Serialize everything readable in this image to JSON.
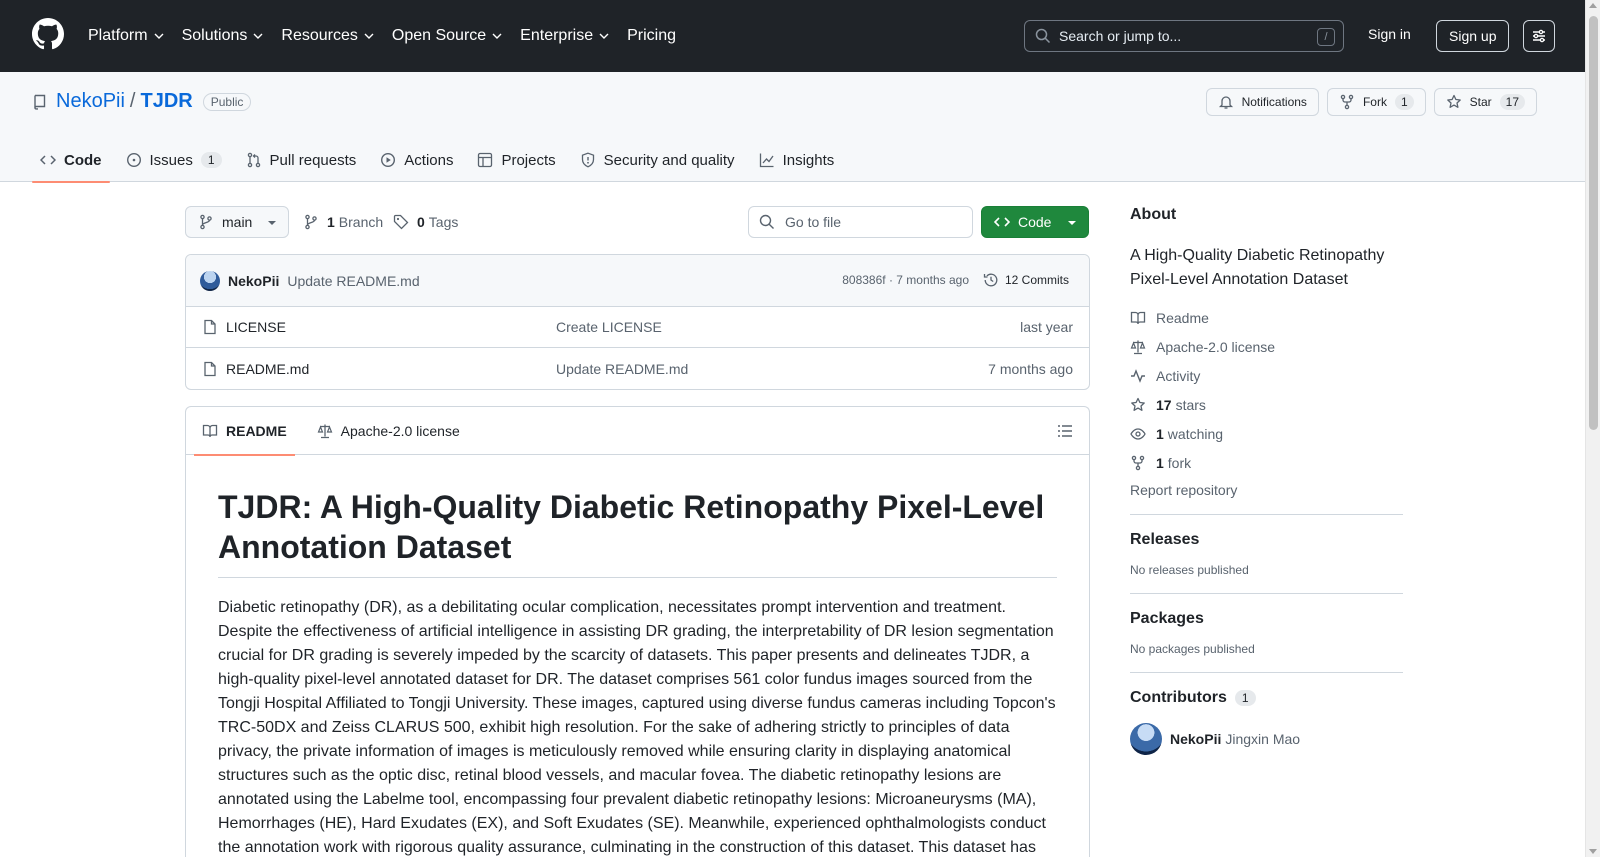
{
  "header": {
    "nav": [
      "Platform",
      "Solutions",
      "Resources",
      "Open Source",
      "Enterprise",
      "Pricing"
    ],
    "search_placeholder": "Search or jump to...",
    "search_shortcut": "/",
    "sign_in": "Sign in",
    "sign_up": "Sign up"
  },
  "repo": {
    "owner": "NekoPii",
    "separator": "/",
    "name": "TJDR",
    "visibility": "Public",
    "actions": {
      "notifications": "Notifications",
      "fork": "Fork",
      "fork_count": "1",
      "star": "Star",
      "star_count": "17"
    },
    "tabs": [
      {
        "label": "Code",
        "icon": "code-icon"
      },
      {
        "label": "Issues",
        "icon": "issue-icon",
        "count": "1"
      },
      {
        "label": "Pull requests",
        "icon": "pull-request-icon"
      },
      {
        "label": "Actions",
        "icon": "play-icon"
      },
      {
        "label": "Projects",
        "icon": "table-icon"
      },
      {
        "label": "Security and quality",
        "icon": "shield-icon"
      },
      {
        "label": "Insights",
        "icon": "graph-icon"
      }
    ]
  },
  "toolbar": {
    "branch": "main",
    "branch_count": "1",
    "branch_label": "Branch",
    "tag_count": "0",
    "tag_label": "Tags",
    "go_to_file": "Go to file",
    "code_button": "Code"
  },
  "latest_commit": {
    "author": "NekoPii",
    "message": "Update README.md",
    "meta": "808386f · 7 months ago",
    "commits": "12 Commits"
  },
  "files": [
    {
      "name": "LICENSE",
      "message": "Create LICENSE",
      "time": "last year"
    },
    {
      "name": "README.md",
      "message": "Update README.md",
      "time": "7 months ago"
    }
  ],
  "readme": {
    "tab_readme": "README",
    "tab_license": "Apache-2.0 license",
    "title": "TJDR: A High-Quality Diabetic Retinopathy Pixel-Level Annotation Dataset",
    "body": "Diabetic retinopathy (DR), as a debilitating ocular complication, necessitates prompt intervention and treatment. Despite the effectiveness of artificial intelligence in assisting DR grading, the interpretability of DR lesion segmentation crucial for DR grading is severely impeded by the scarcity of datasets. This paper presents and delineates TJDR, a high-quality pixel-level annotated dataset for DR. The dataset comprises 561 color fundus images sourced from the Tongji Hospital Affiliated to Tongji University. These images, captured using diverse fundus cameras including Topcon's TRC-50DX and Zeiss CLARUS 500, exhibit high resolution. For the sake of adhering strictly to principles of data privacy, the private information of images is meticulously removed while ensuring clarity in displaying anatomical structures such as the optic disc, retinal blood vessels, and macular fovea. The diabetic retinopathy lesions are annotated using the Labelme tool, encompassing four prevalent diabetic retinopathy lesions: Microaneurysms (MA), Hemorrhages (HE), Hard Exudates (EX), and Soft Exudates (SE). Meanwhile, experienced ophthalmologists conduct the annotation work with rigorous quality assurance, culminating in the construction of this dataset. This dataset has"
  },
  "sidebar": {
    "about_title": "About",
    "description": "A High-Quality Diabetic Retinopathy Pixel-Level Annotation Dataset",
    "links": [
      {
        "icon": "book-icon",
        "label": "Readme"
      },
      {
        "icon": "law-icon",
        "label": "Apache-2.0 license"
      },
      {
        "icon": "pulse-icon",
        "label": "Activity"
      },
      {
        "icon": "star-icon",
        "count": "17",
        "label": "stars"
      },
      {
        "icon": "eye-icon",
        "count": "1",
        "label": "watching"
      },
      {
        "icon": "fork-icon",
        "count": "1",
        "label": "fork"
      }
    ],
    "report": "Report repository",
    "releases_title": "Releases",
    "releases_empty": "No releases published",
    "packages_title": "Packages",
    "packages_empty": "No packages published",
    "contributors_title": "Contributors",
    "contributors_count": "1",
    "contributor_login": "NekoPii",
    "contributor_name": "Jingxin Mao"
  },
  "colors": {
    "header_bg": "#1f2328",
    "link": "#0969da",
    "code_button": "#1f883d",
    "tab_underline": "#fd8c73"
  }
}
